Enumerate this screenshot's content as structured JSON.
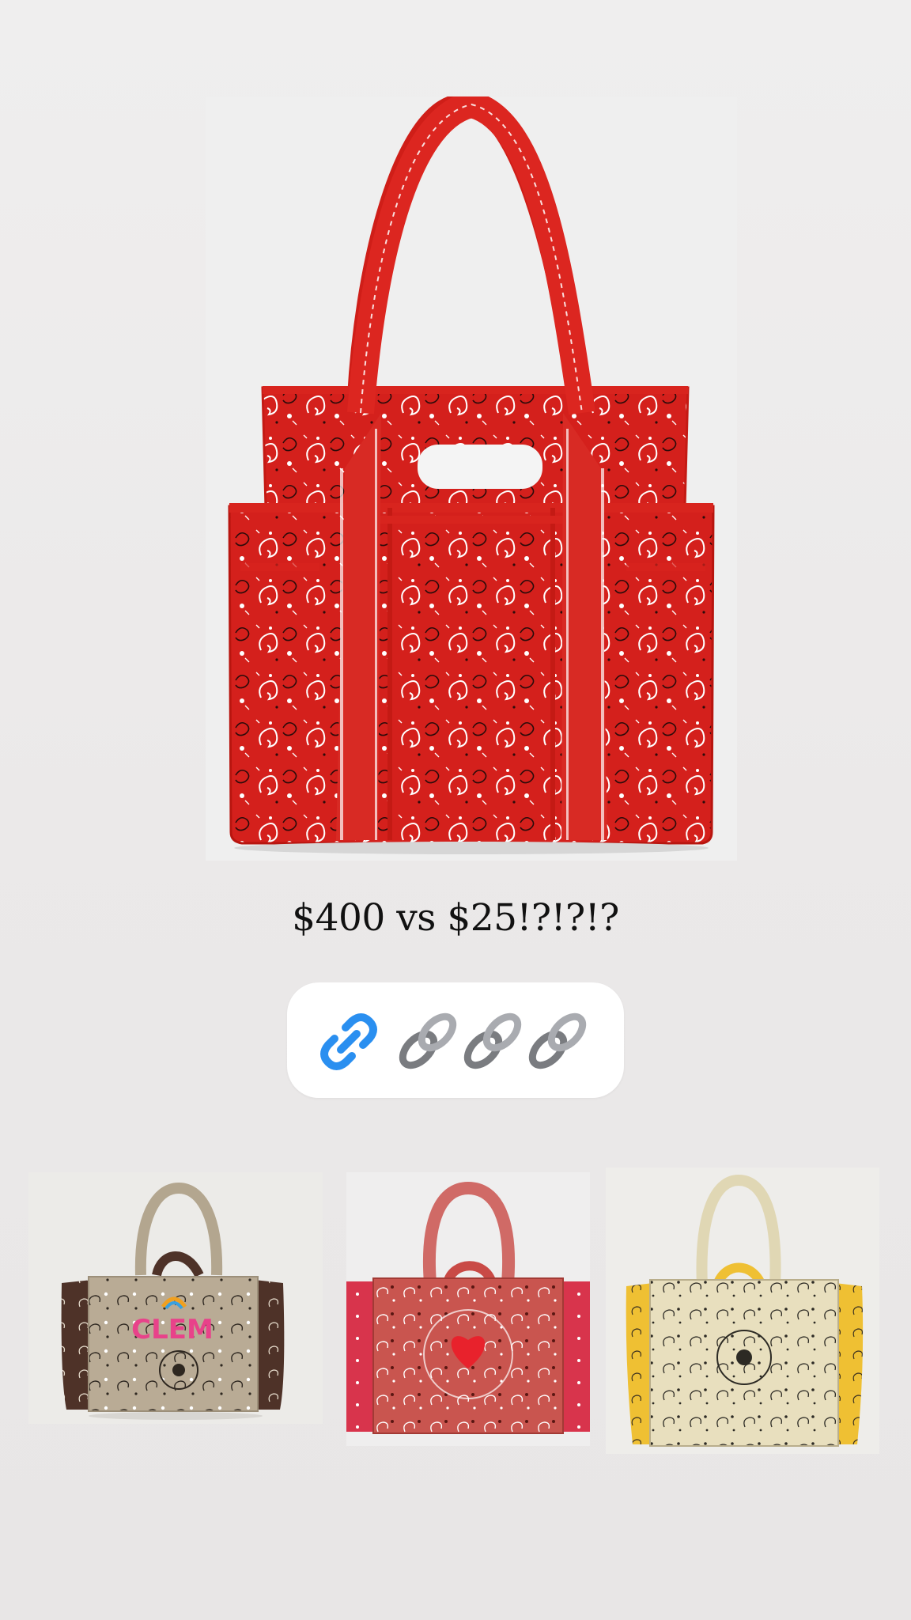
{
  "story": {
    "caption": "$400 vs $25!?!?!?"
  },
  "link_sticker": {
    "icons": [
      "link-icon",
      "chain-icon",
      "chain-icon",
      "chain-icon"
    ],
    "link_color": "#2a8ff0",
    "chain_color": "#7a7c80"
  },
  "products": {
    "main": {
      "name": "red bandana tote bag",
      "color": "#d4201c"
    },
    "thumbnails": [
      {
        "name": "khaki bandana tote with CLEM lettering",
        "color": "#b9ab95",
        "text": "CLEM"
      },
      {
        "name": "red bandana tote with heart",
        "color": "#c9554f"
      },
      {
        "name": "cream bandana tote with yellow sides",
        "color": "#e8dfbe"
      }
    ]
  }
}
